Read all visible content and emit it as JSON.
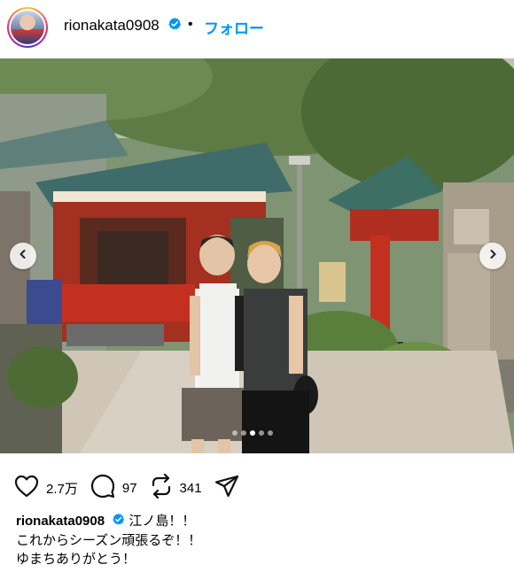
{
  "header": {
    "username": "rionakata0908",
    "separator": "•",
    "follow_label": "フォロー"
  },
  "icons": {
    "verified": "verified-badge-icon",
    "prev": "chevron-left-icon",
    "next": "chevron-right-icon",
    "like": "heart-icon",
    "comment": "comment-icon",
    "repost": "repost-icon",
    "share": "send-icon"
  },
  "carousel": {
    "slide_count": 5,
    "active_index": 3
  },
  "stats": {
    "likes": "2.7万",
    "comments": "97",
    "reposts": "341"
  },
  "caption": {
    "username": "rionakata0908",
    "line1": "江ノ島！！",
    "line2": "これからシーズン頑張るぞ！！",
    "line3": "ゆまちありがとう！"
  },
  "colors": {
    "accent": "#0095f6",
    "verified": "#0095f6"
  }
}
